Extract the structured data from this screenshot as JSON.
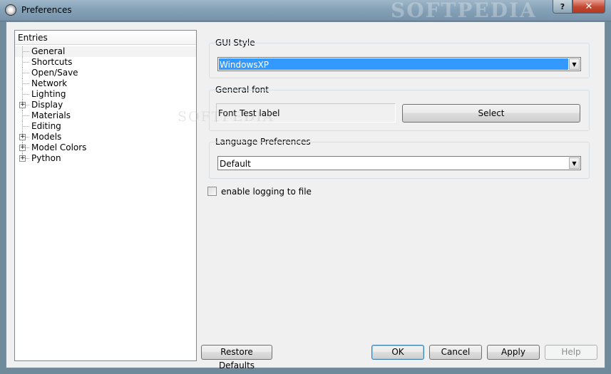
{
  "window": {
    "title": "Preferences",
    "watermark": "SOFTPEDIA",
    "help_button": "?",
    "close_button": "✕"
  },
  "tree": {
    "header": "Entries",
    "items": [
      {
        "label": "General",
        "expandable": false
      },
      {
        "label": "Shortcuts",
        "expandable": false
      },
      {
        "label": "Open/Save",
        "expandable": false
      },
      {
        "label": "Network",
        "expandable": false
      },
      {
        "label": "Lighting",
        "expandable": false
      },
      {
        "label": "Display",
        "expandable": true
      },
      {
        "label": "Materials",
        "expandable": false
      },
      {
        "label": "Editing",
        "expandable": false
      },
      {
        "label": "Models",
        "expandable": true
      },
      {
        "label": "Model Colors",
        "expandable": true
      },
      {
        "label": "Python",
        "expandable": true
      }
    ],
    "expand_glyph": "+"
  },
  "gui_style": {
    "label": "GUI Style",
    "value": "WindowsXP"
  },
  "general_font": {
    "label": "General font",
    "sample": "Font Test label",
    "select_label": "Select"
  },
  "language": {
    "label": "Language Preferences",
    "value": "Default"
  },
  "logging": {
    "label": "enable logging to file",
    "checked": false
  },
  "buttons": {
    "restore": "Restore Defaults",
    "ok": "OK",
    "cancel": "Cancel",
    "apply": "Apply",
    "help": "Help"
  },
  "colors": {
    "selection": "#3399ff",
    "window_bg": "#f0f0f0"
  }
}
